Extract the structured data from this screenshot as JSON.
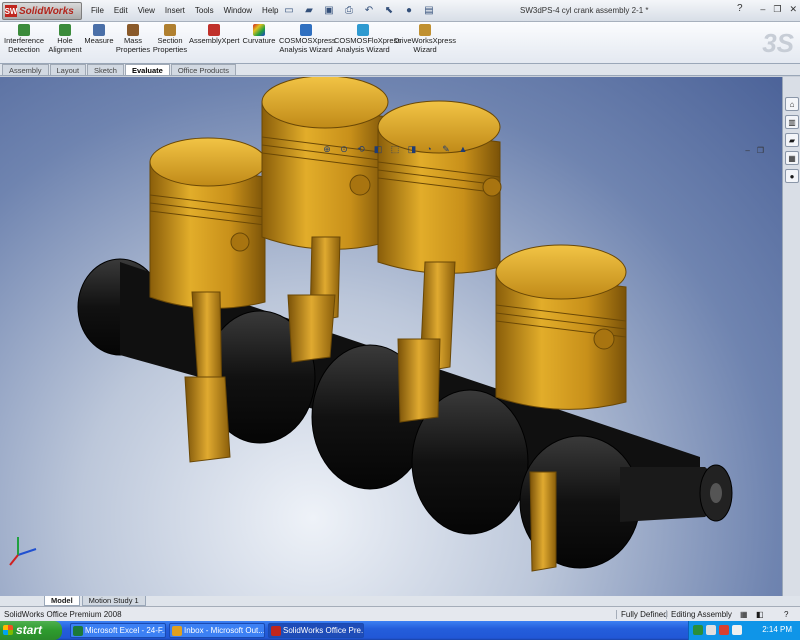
{
  "app": {
    "logo_text": "SolidWorks",
    "logo_mark": "SW",
    "document_title": "SW3dPS-4 cyl crank assembly 2-1 *"
  },
  "menus": [
    "File",
    "Edit",
    "View",
    "Insert",
    "Tools",
    "Window",
    "Help"
  ],
  "command_manager": [
    {
      "label_1": "Interference",
      "label_2": "Detection",
      "icon": "interference-icon",
      "color": "#3b8b3b"
    },
    {
      "label_1": "Hole",
      "label_2": "Alignment",
      "icon": "hole-alignment-icon",
      "color": "#3b8b3b"
    },
    {
      "label_1": "Measure",
      "label_2": "",
      "icon": "measure-icon",
      "color": "#4a6fa8"
    },
    {
      "label_1": "Mass",
      "label_2": "Properties",
      "icon": "mass-properties-icon",
      "color": "#8a5a2a"
    },
    {
      "label_1": "Section",
      "label_2": "Properties",
      "icon": "section-properties-icon",
      "color": "#b08030"
    },
    {
      "label_1": "AssemblyXpert",
      "label_2": "",
      "icon": "assemblyxpert-icon",
      "color": "#c0302a"
    },
    {
      "label_1": "Curvature",
      "label_2": "",
      "icon": "curvature-icon",
      "color": "#7a3fb0"
    },
    {
      "label_1": "COSMOSXpress",
      "label_2": "Analysis Wizard",
      "icon": "cosmosxpress-icon",
      "color": "#3070c0"
    },
    {
      "label_1": "COSMOSFloXpress",
      "label_2": "Analysis Wizard",
      "icon": "cosmosfloxpress-icon",
      "color": "#2f9ad0"
    },
    {
      "label_1": "DriveWorksXpress",
      "label_2": "Wizard",
      "icon": "driveworks-icon",
      "color": "#c09030"
    }
  ],
  "command_tabs": [
    {
      "label": "Assembly",
      "active": false
    },
    {
      "label": "Layout",
      "active": false
    },
    {
      "label": "Sketch",
      "active": false
    },
    {
      "label": "Evaluate",
      "active": true
    },
    {
      "label": "Office Products",
      "active": false
    }
  ],
  "model_tabs": [
    {
      "label": "Model",
      "active": true
    },
    {
      "label": "Motion Study 1",
      "active": false
    }
  ],
  "status": {
    "product": "SolidWorks Office Premium 2008",
    "state": "Fully Defined",
    "mode": "Editing Assembly"
  },
  "taskbar": {
    "start_label": "start",
    "tasks": [
      {
        "label": "Microsoft Excel - 24-F...",
        "icon": "excel-icon",
        "color": "#1d7a3a",
        "active": false
      },
      {
        "label": "Inbox - Microsoft Out...",
        "icon": "outlook-icon",
        "color": "#e0a020",
        "active": false
      },
      {
        "label": "SolidWorks Office Pre...",
        "icon": "solidworks-icon",
        "color": "#c0261e",
        "active": true
      }
    ],
    "clock": "2:14 PM"
  },
  "colors": {
    "piston": "#d8a21c",
    "rod": "#c8901a",
    "crank": "#151515",
    "viewport_bg": "#6f84b0"
  }
}
